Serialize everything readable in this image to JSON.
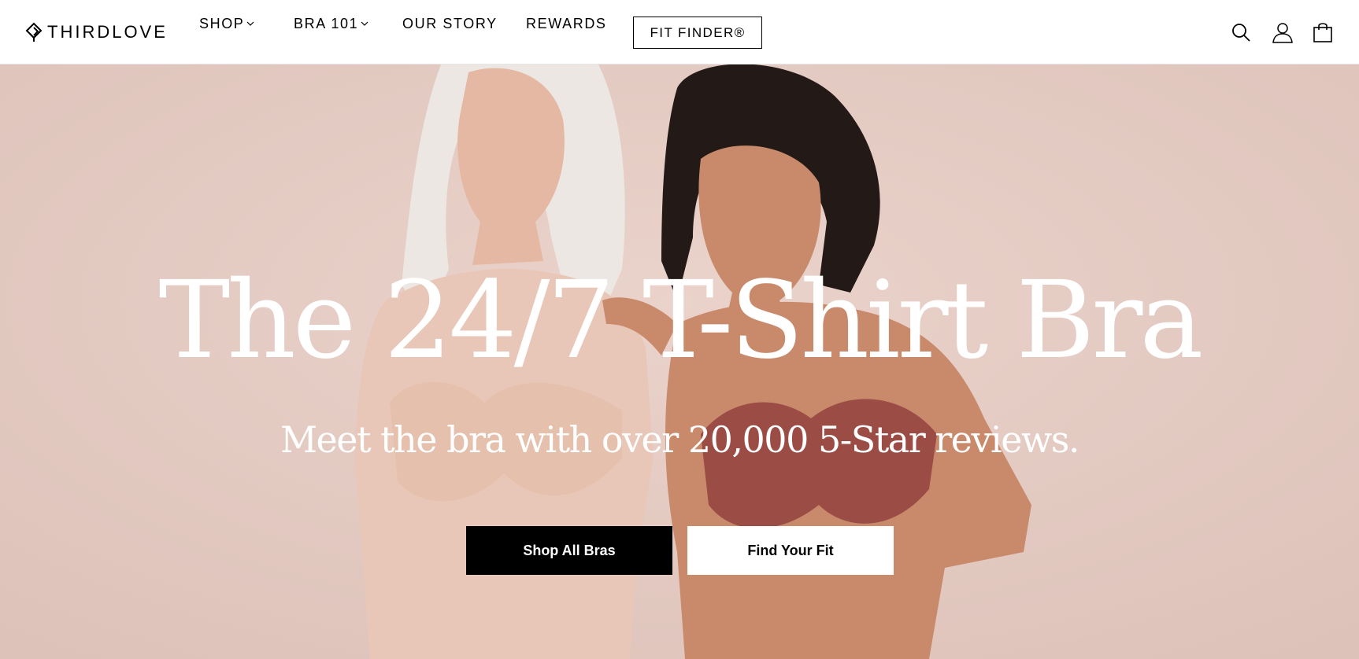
{
  "brand": {
    "name": "THIRDLOVE"
  },
  "nav": {
    "shop": "SHOP",
    "bra101": "BRA 101",
    "our_story": "OUR STORY",
    "rewards": "REWARDS",
    "fit_finder": "FIT FINDER®"
  },
  "header_icons": [
    "search-icon",
    "account-icon",
    "shopping-bag-icon"
  ],
  "hero": {
    "headline": "The 24/7 T-Shirt Bra",
    "subhead": "Meet the bra with over 20,000 5-Star reviews.",
    "primary_cta": "Shop All Bras",
    "secondary_cta": "Find Your Fit"
  },
  "colors": {
    "background": "#e3cbc3",
    "skin_light": "#e9c7b8",
    "skin_dark": "#c98a6c",
    "bra_nude": "#e4c0ad",
    "bra_rust": "#9a4c45",
    "hair_dark": "#231a17",
    "hair_grey": "#ece7e2",
    "button_dark": "#000000"
  }
}
